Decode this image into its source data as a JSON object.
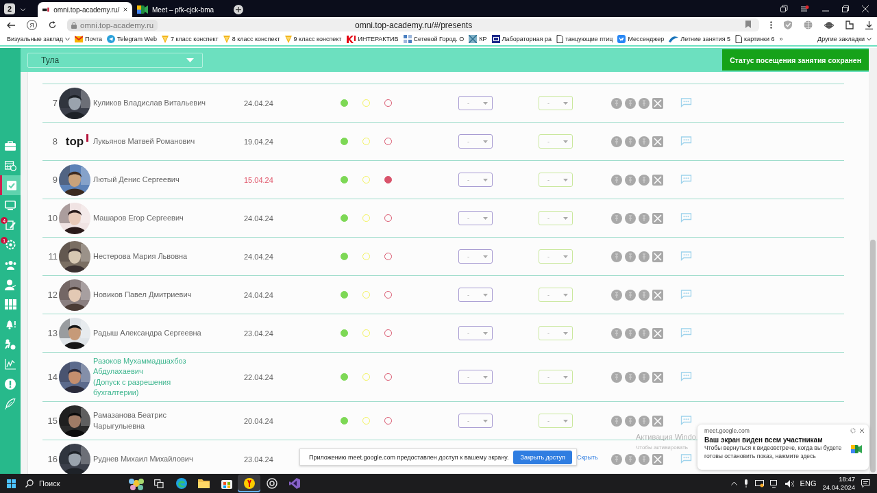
{
  "browser": {
    "tab_count": "2",
    "tabs": [
      {
        "title": "omni.top-academy.ru/",
        "kind": "site",
        "selected": true
      },
      {
        "title": "Meet – pfk-cjck-bma",
        "kind": "meet",
        "selected": false
      }
    ],
    "home_button": "Я",
    "address": {
      "site": "omni.top-academy.ru",
      "url": "omni.top-academy.ru/#/presents"
    },
    "bookmarks": [
      {
        "label": "Визуальные заклад",
        "kind": "menu"
      },
      {
        "label": "Почта",
        "kind": "mail"
      },
      {
        "label": "Telegram Web",
        "kind": "telegram"
      },
      {
        "label": "7 класс конспект",
        "kind": "fox"
      },
      {
        "label": "8 класс конспект",
        "kind": "fox"
      },
      {
        "label": "9 класс конспект",
        "kind": "fox"
      },
      {
        "label": "ИНТЕРАКТИВ",
        "kind": "k"
      },
      {
        "label": "Сетевой Город. О",
        "kind": "grid"
      },
      {
        "label": "КР",
        "kind": "kr"
      },
      {
        "label": "Лабораторная ра",
        "kind": "lab"
      },
      {
        "label": "танцующие птиц",
        "kind": "doc"
      },
      {
        "label": "Мессенджер",
        "kind": "vk"
      },
      {
        "label": "Летние занятия 5",
        "kind": "wave"
      },
      {
        "label": "картинки 6",
        "kind": "doc"
      }
    ],
    "more": "»",
    "other_bookmarks": "Другие закладки"
  },
  "sidebar": {
    "items": [
      {
        "kind": "briefcase",
        "selected": false
      },
      {
        "kind": "calendar",
        "selected": false
      },
      {
        "kind": "check",
        "selected": true
      },
      {
        "kind": "monitor",
        "selected": false
      },
      {
        "kind": "homework",
        "selected": false,
        "badge": "4"
      },
      {
        "kind": "gear",
        "selected": false,
        "badge": "1"
      },
      {
        "kind": "group",
        "selected": false
      },
      {
        "kind": "teacher",
        "selected": false
      },
      {
        "kind": "books",
        "selected": false
      },
      {
        "kind": "bell",
        "selected": false
      },
      {
        "kind": "runner",
        "selected": false
      },
      {
        "kind": "chart",
        "selected": false
      },
      {
        "kind": "alert",
        "selected": false
      },
      {
        "kind": "feather",
        "selected": false
      }
    ]
  },
  "header": {
    "city": "Тула"
  },
  "toast": "Статус посещения занятия сохранен",
  "students": [
    {
      "number": "7",
      "name": "Куликов Владислав Витальевич",
      "highlight": false,
      "date": "24.04.24",
      "overdue": false,
      "present": true,
      "late": false,
      "absent": false,
      "grade_1": "-",
      "grade_2": "-"
    },
    {
      "number": "8",
      "avatar": {
        "kind": "logo",
        "text": "top"
      },
      "name": "Лукьянов Матвей Романович",
      "highlight": false,
      "date": "19.04.24",
      "overdue": false,
      "present": true,
      "late": false,
      "absent": false,
      "grade_1": "-",
      "grade_2": "-"
    },
    {
      "number": "9",
      "name": "Лютый Денис Сергеевич",
      "highlight": false,
      "date": "15.04.24",
      "overdue": true,
      "present": true,
      "late": false,
      "absent": true,
      "grade_1": "-",
      "grade_2": "-"
    },
    {
      "number": "10",
      "name": "Машаров Егор Сергеевич",
      "highlight": false,
      "date": "24.04.24",
      "overdue": false,
      "present": true,
      "late": false,
      "absent": false,
      "grade_1": "-",
      "grade_2": "-"
    },
    {
      "number": "11",
      "name": "Нестерова Мария Львовна",
      "highlight": false,
      "date": "24.04.24",
      "overdue": false,
      "present": true,
      "late": false,
      "absent": false,
      "grade_1": "-",
      "grade_2": "-"
    },
    {
      "number": "12",
      "name": "Новиков Павел Дмитриевич",
      "highlight": false,
      "date": "24.04.24",
      "overdue": false,
      "present": true,
      "late": false,
      "absent": false,
      "grade_1": "-",
      "grade_2": "-"
    },
    {
      "number": "13",
      "name": "Радыш Александра Сергеевна",
      "highlight": false,
      "date": "23.04.24",
      "overdue": false,
      "present": true,
      "late": false,
      "absent": false,
      "grade_1": "-",
      "grade_2": "-"
    },
    {
      "number": "14",
      "name": "Разоков Мухаммадшахбоз Абдулахаевич",
      "note": "(Допуск с разрешения бухгалтерии)",
      "highlight": true,
      "date": "22.04.24",
      "overdue": false,
      "present": true,
      "late": false,
      "absent": false,
      "grade_1": "-",
      "grade_2": "-"
    },
    {
      "number": "15",
      "name": "Рамазанова Беатрис Чарыгулыевна",
      "highlight": false,
      "date": "20.04.24",
      "overdue": false,
      "present": true,
      "late": false,
      "absent": false,
      "grade_1": "-",
      "grade_2": "-"
    },
    {
      "number": "16",
      "name": "Руднев Михаил Михайлович",
      "highlight": false,
      "date": "23.04.24",
      "overdue": false
    }
  ],
  "share_bar": {
    "message": "Приложению meet.google.com предоставлен доступ к вашему экрану.",
    "stop": "Закрыть доступ",
    "hide": "Скрыть"
  },
  "activation": {
    "title": "Активация Windo",
    "text": "Чтобы активировать"
  },
  "notification": {
    "source": "meet.google.com",
    "title": "Ваш экран виден всем участникам",
    "body": "Чтобы вернуться к видеовстрече, когда вы будете готовы остановить показ, нажмите здесь"
  },
  "taskbar": {
    "search": "Поиск",
    "apps": [
      {
        "kind": "flower",
        "selected": false
      },
      {
        "kind": "taskview",
        "selected": false
      },
      {
        "kind": "edge",
        "selected": false
      },
      {
        "kind": "explorer",
        "selected": false
      },
      {
        "kind": "store",
        "selected": false
      },
      {
        "kind": "yandex",
        "selected": true
      },
      {
        "kind": "swirl",
        "selected": false
      },
      {
        "kind": "vs",
        "selected": false
      }
    ],
    "lang": "ENG",
    "time": "18:47",
    "date": "24.04.2024"
  }
}
